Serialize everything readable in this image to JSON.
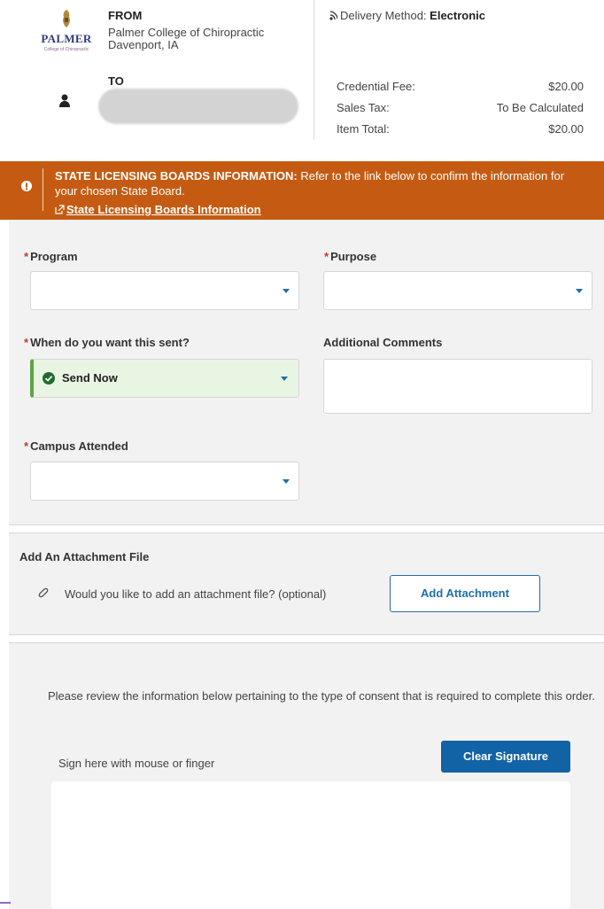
{
  "header": {
    "logo": {
      "word": "PALMER",
      "sub": "College of Chiropractic"
    },
    "from_label": "FROM",
    "from_name_line1": "Palmer College of Chiropractic",
    "from_name_line2": "Davenport, IA",
    "to_label": "TO",
    "delivery_label": "Delivery Method:",
    "delivery_value": "Electronic",
    "fees": [
      {
        "label": "Credential Fee:",
        "value": "$20.00"
      },
      {
        "label": "Sales Tax:",
        "value": "To Be Calculated"
      },
      {
        "label": "Item Total:",
        "value": "$20.00"
      }
    ]
  },
  "alert": {
    "title": "STATE LICENSING BOARDS INFORMATION:",
    "body": " Refer to the link below to confirm the information for your chosen State Board.",
    "link": "State Licensing Boards Information",
    "color": "#c55b12"
  },
  "form": {
    "required_mark": "*",
    "program_label": "Program",
    "purpose_label": "Purpose",
    "when_label": "When do you want this sent?",
    "when_value": "Send Now",
    "comments_label": "Additional Comments",
    "campus_label": "Campus Attended"
  },
  "attachment": {
    "title": "Add An Attachment File",
    "question": "Would you like to add an attachment file? (optional)",
    "button": "Add Attachment"
  },
  "consent": {
    "text": "Please review the information below pertaining to the type of consent that is required to complete this order.",
    "sign_label": "Sign here with mouse or finger",
    "clear_button": "Clear Signature"
  },
  "colors": {
    "accent_blue": "#1262a6",
    "success_green": "#5ba644",
    "required_red": "#c0392b"
  }
}
